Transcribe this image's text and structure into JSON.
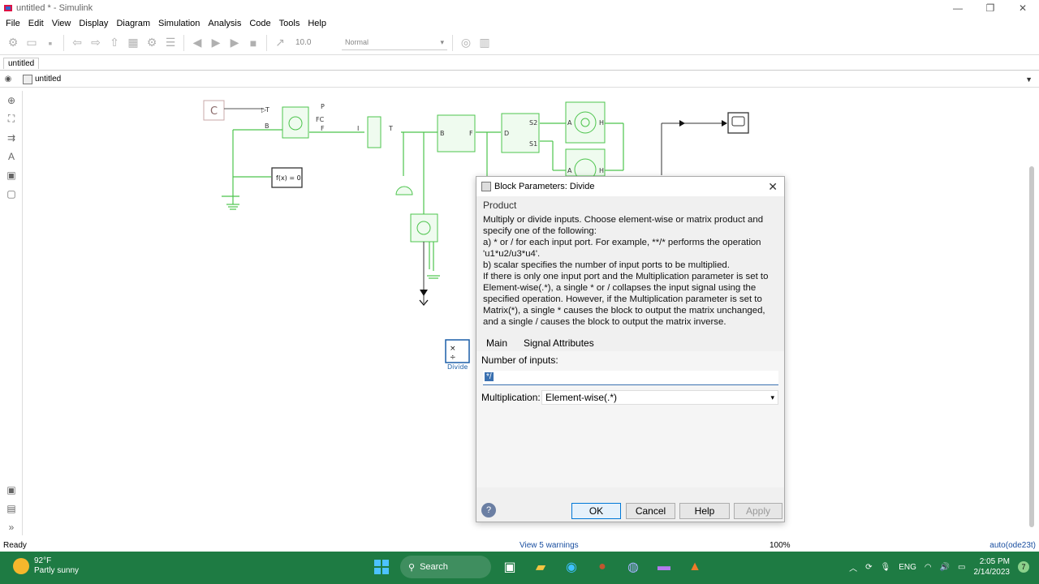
{
  "window": {
    "title": "untitled * - Simulink"
  },
  "menu": [
    "File",
    "Edit",
    "View",
    "Display",
    "Diagram",
    "Simulation",
    "Analysis",
    "Code",
    "Tools",
    "Help"
  ],
  "toolbar": {
    "stop_time": "10.0",
    "mode": "Normal"
  },
  "tab": {
    "label": "untitled"
  },
  "address": {
    "label": "untitled"
  },
  "diagram": {
    "const_label": "C",
    "block_fx": "f(x) = 0",
    "divide_label": "Divide",
    "labels": {
      "T": "T",
      "B": "B",
      "P": "P",
      "FC": "FC",
      "F": "F",
      "I": "I",
      "S2": "S2",
      "S1": "S1",
      "A": "A",
      "H": "H",
      "D": "D"
    }
  },
  "dialog": {
    "title": "Block Parameters: Divide",
    "section": "Product",
    "desc": "Multiply or divide inputs.  Choose element-wise or matrix product and specify one of the following:\n a) * or / for each input port. For example, **/* performs the operation 'u1*u2/u3*u4'.\n b) scalar specifies the number of input ports to be multiplied.\nIf there is only one input port and the Multiplication parameter is set to Element-wise(.*), a single * or / collapses the input signal using the specified operation. However, if the Multiplication parameter is set to Matrix(*), a single * causes the block to output the matrix unchanged, and a single / causes the block to output the matrix inverse.",
    "tabs": [
      "Main",
      "Signal Attributes"
    ],
    "num_inputs_label": "Number of inputs:",
    "num_inputs_value": "*/",
    "mult_label": "Multiplication:",
    "mult_value": "Element-wise(.*)",
    "buttons": {
      "ok": "OK",
      "cancel": "Cancel",
      "help": "Help",
      "apply": "Apply"
    }
  },
  "status": {
    "ready": "Ready",
    "warnings": "View 5 warnings",
    "zoom": "100%",
    "solver": "auto(ode23t)"
  },
  "taskbar": {
    "temp": "92°F",
    "weather": "Partly sunny",
    "search": "Search",
    "lang": "ENG",
    "time": "2:05 PM",
    "date": "2/14/2023",
    "badge": "7"
  }
}
